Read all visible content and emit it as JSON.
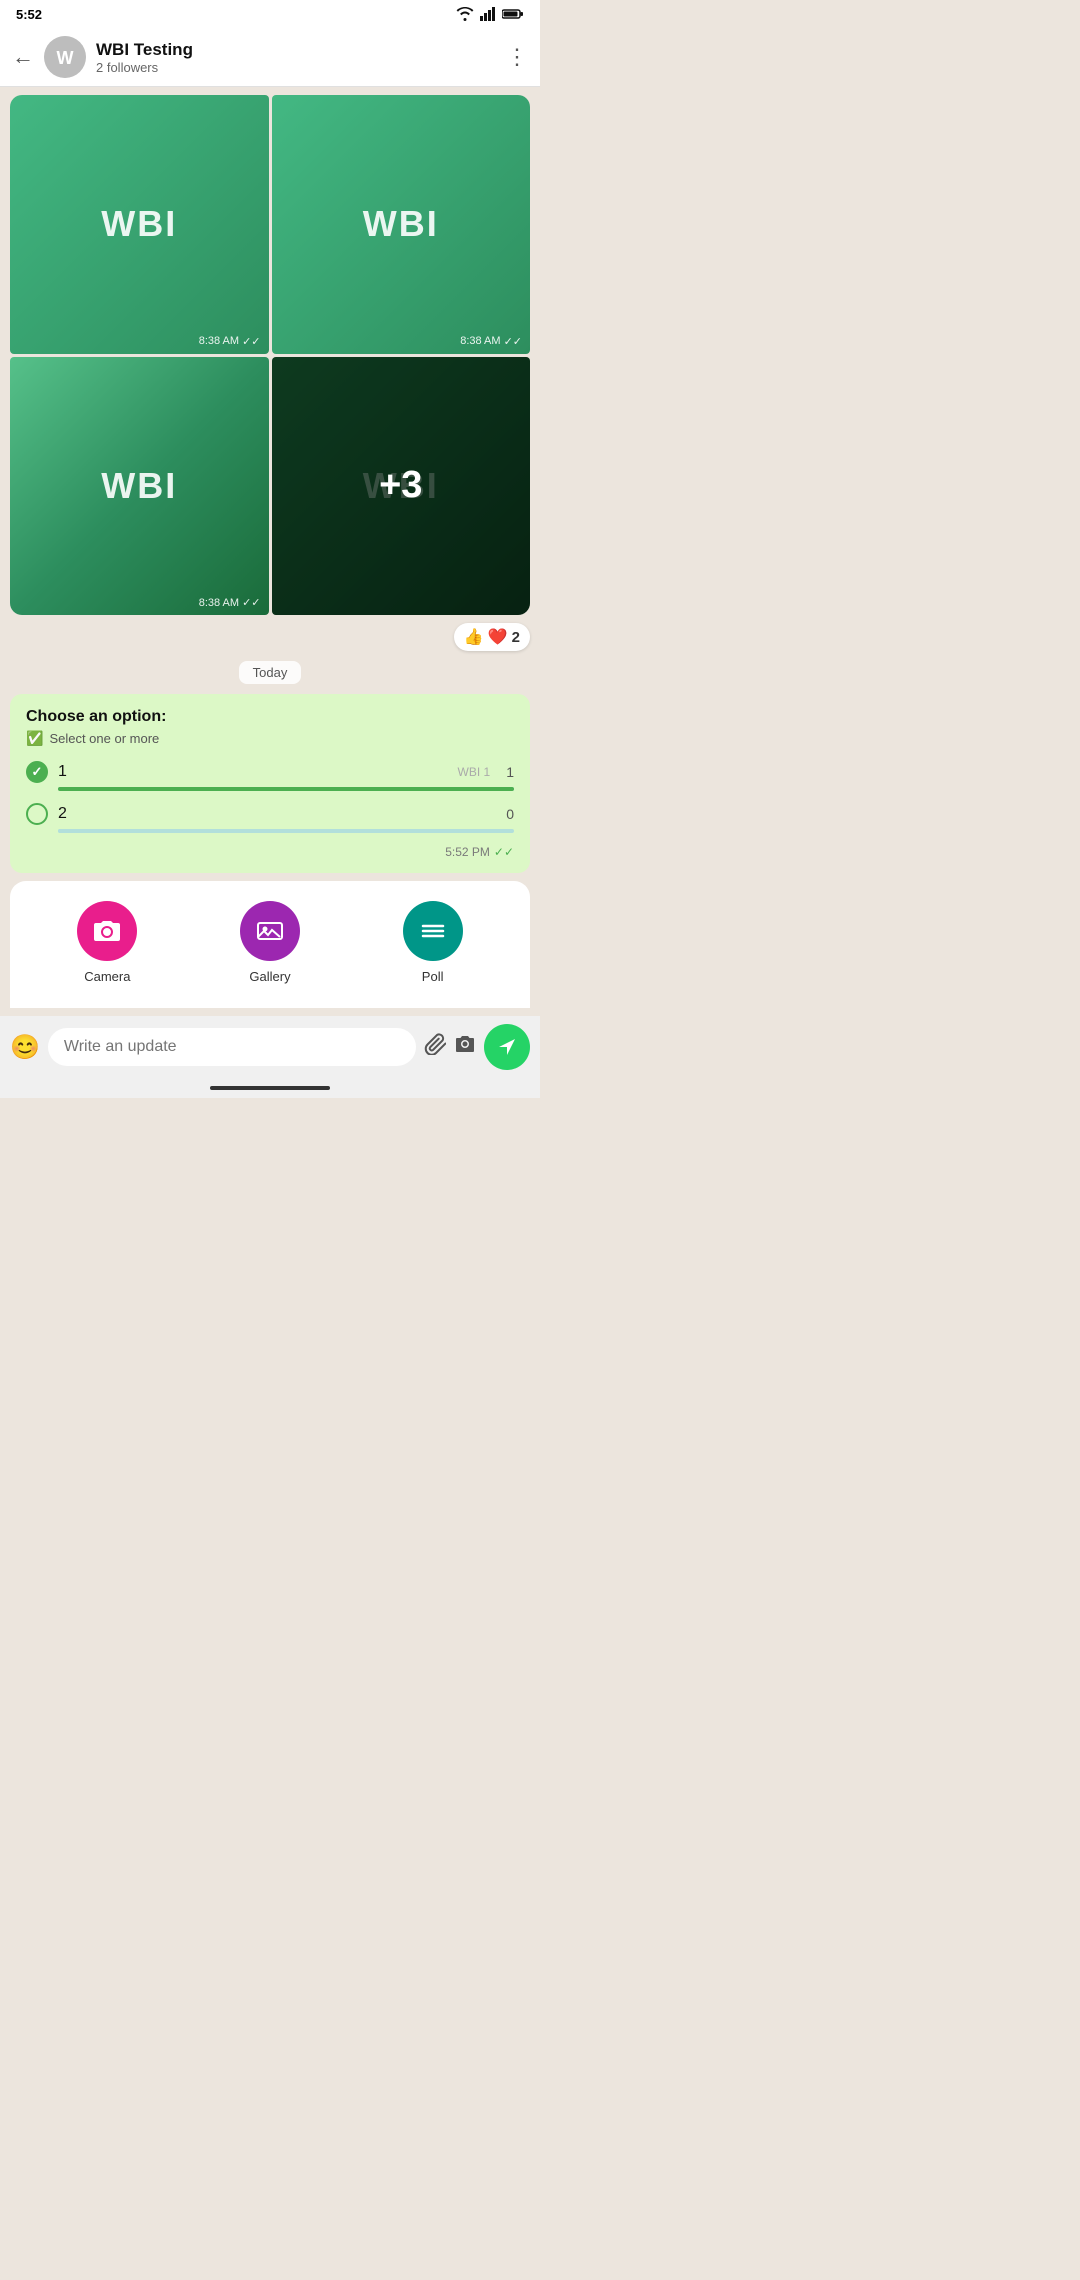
{
  "statusBar": {
    "time": "5:52",
    "icons": [
      "wifi",
      "signal",
      "battery"
    ]
  },
  "header": {
    "backLabel": "←",
    "name": "WBI Testing",
    "subtitle": "2 followers",
    "moreLabel": "⋮"
  },
  "imageGrid": [
    {
      "id": "img1",
      "style": "green",
      "time": "8:38 AM",
      "position": "tl"
    },
    {
      "id": "img2",
      "style": "green",
      "time": "8:38 AM",
      "position": "tr"
    },
    {
      "id": "img3",
      "style": "green-gradient",
      "time": "8:38 AM",
      "position": "bl"
    },
    {
      "id": "img4",
      "style": "dark-more",
      "more": "+3",
      "position": "br"
    }
  ],
  "reactions": {
    "emoji1": "👍",
    "emoji2": "❤️",
    "count": "2"
  },
  "todayDivider": "Today",
  "poll": {
    "title": "Choose an option:",
    "subtitleIcon": "✅",
    "subtitleText": "Select one or more",
    "options": [
      {
        "label": "1",
        "selected": true,
        "count": "1",
        "barPercent": 100,
        "badge": "WBI 1"
      },
      {
        "label": "2",
        "selected": false,
        "count": "0",
        "barPercent": 30,
        "badge": ""
      }
    ],
    "timestamp": "5:52 PM",
    "checkmarks": "✓✓"
  },
  "attachmentPanel": {
    "items": [
      {
        "id": "camera",
        "label": "Camera",
        "icon": "📷",
        "color": "#e91e8c"
      },
      {
        "id": "gallery",
        "label": "Gallery",
        "icon": "🖼",
        "color": "#9c27b0"
      },
      {
        "id": "poll",
        "label": "Poll",
        "icon": "≡",
        "color": "#009688"
      }
    ]
  },
  "inputBar": {
    "placeholder": "Write an update",
    "emojiIcon": "😊",
    "attachIcon": "📎",
    "cameraIcon": "📷",
    "sendIcon": "➤"
  }
}
